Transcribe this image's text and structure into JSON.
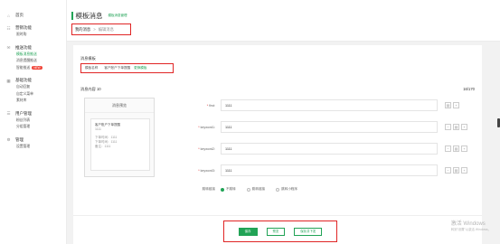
{
  "sidebar": {
    "home": "首页",
    "marketing": {
      "title": "营销功能",
      "items": [
        "限时购"
      ]
    },
    "push": {
      "title": "推送功能",
      "items": [
        "模板消息推送",
        "消息提醒推送",
        "智能推送"
      ],
      "badge": "NEW"
    },
    "basic": {
      "title": "基础功能",
      "items": [
        "自动回复",
        "自定义菜单",
        "素材库"
      ]
    },
    "users": {
      "title": "用户管理",
      "items": [
        "粉丝列表",
        "分组管理"
      ]
    },
    "manage": {
      "title": "管理",
      "items": [
        "设置管理"
      ]
    }
  },
  "header": {
    "title": "模板消息",
    "subtitle": "模板消息管理",
    "breadcrumb": {
      "current": "我的消息",
      "separator": ">",
      "next": "编辑消息"
    }
  },
  "main": {
    "section_label": "消息模板",
    "template": {
      "label": "模板名称",
      "name": "客户账户下单提醒",
      "action": "更换模板"
    },
    "content_label": "消息内容",
    "content_value": "10",
    "count": "16/170",
    "preview": {
      "title": "消息预览",
      "card_title": "客户账户下单提醒",
      "first": "1111",
      "lines": [
        "下单时间：1111",
        "下单时间：1111",
        "备注：1111"
      ]
    },
    "fields": [
      {
        "label": "first",
        "value": "1111"
      },
      {
        "label": "keyword1",
        "value": "1111"
      },
      {
        "label": "keyword2",
        "value": "1111"
      },
      {
        "label": "keyword3",
        "value": "1111"
      }
    ],
    "jump": {
      "label": "跳转链接",
      "options": [
        "不跳转",
        "跳转链接",
        "跳转小程序"
      ],
      "selected": 0
    }
  },
  "footer": {
    "save": "保存",
    "preview": "预览",
    "save_send": "保存并下发"
  },
  "watermark": {
    "line1": "激活 Windows",
    "line2": "转到\"设置\"以激活 Windows。"
  },
  "colors": {
    "accent": "#21a356",
    "highlight": "#e02525"
  }
}
